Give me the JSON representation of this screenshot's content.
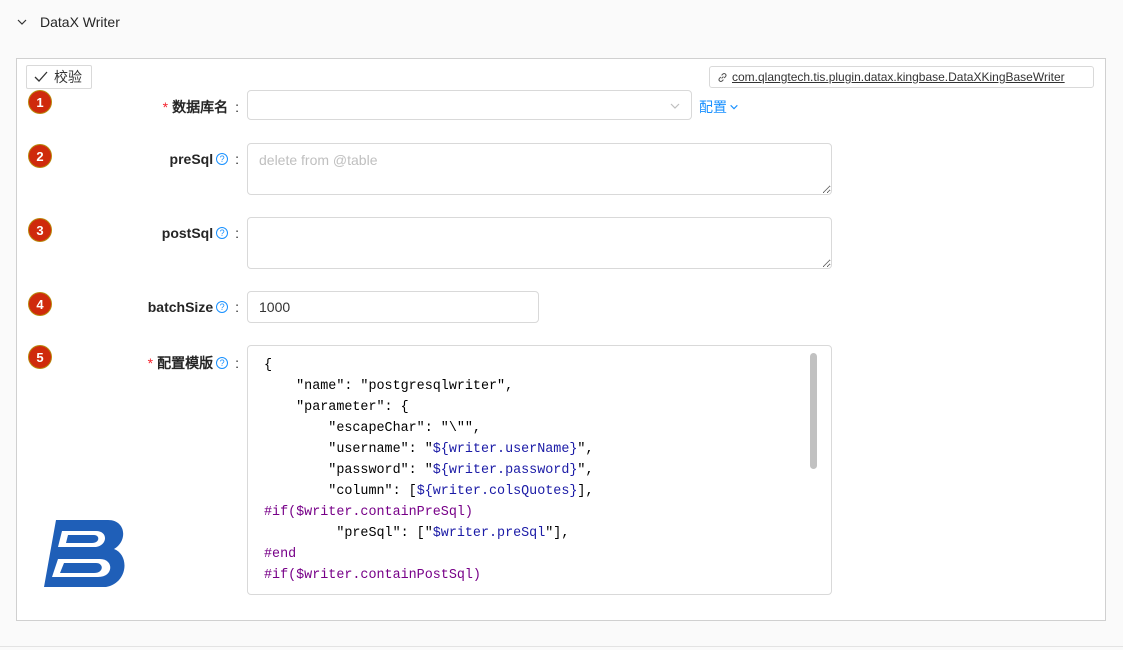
{
  "panel": {
    "title": "DataX Writer"
  },
  "toolbar": {
    "verify_label": "校验",
    "plugin_class": "com.qlangtech.tis.plugin.datax.kingbase.DataXKingBaseWriter"
  },
  "fields": {
    "dbName": {
      "badge": "1",
      "label": "数据库名",
      "required": "*",
      "colon": ":",
      "value": "",
      "config_label": "配置"
    },
    "preSql": {
      "badge": "2",
      "label": "preSql",
      "colon": ":",
      "placeholder": "delete from @table",
      "value": ""
    },
    "postSql": {
      "badge": "3",
      "label": "postSql",
      "colon": ":",
      "value": ""
    },
    "batchSize": {
      "badge": "4",
      "label": "batchSize",
      "colon": ":",
      "value": "1000"
    },
    "template": {
      "badge": "5",
      "label": "配置模版",
      "required": "*",
      "colon": ":",
      "lines": [
        "{",
        "    \"name\": \"postgresqlwriter\",",
        "    \"parameter\": {",
        "        \"escapeChar\": \"\\\"\",",
        "        \"username\": \"${writer.userName}\",",
        "        \"password\": \"${writer.password}\",",
        "        \"column\": [${writer.colsQuotes}],",
        "#if($writer.containPreSql)",
        "         \"preSql\": [\"$writer.preSql\"],",
        "#end",
        "#if($writer.containPostSql)"
      ]
    }
  },
  "icons": {
    "collapse": "chevron-down-icon",
    "verify": "check-icon",
    "plugin": "link-icon",
    "help": "question-circle-icon",
    "logo": "kingbase-logo"
  },
  "colors": {
    "accent": "#1890ff",
    "required": "#f5222d",
    "badge": "#cf2a0c",
    "logo": "#1f5fb8"
  }
}
